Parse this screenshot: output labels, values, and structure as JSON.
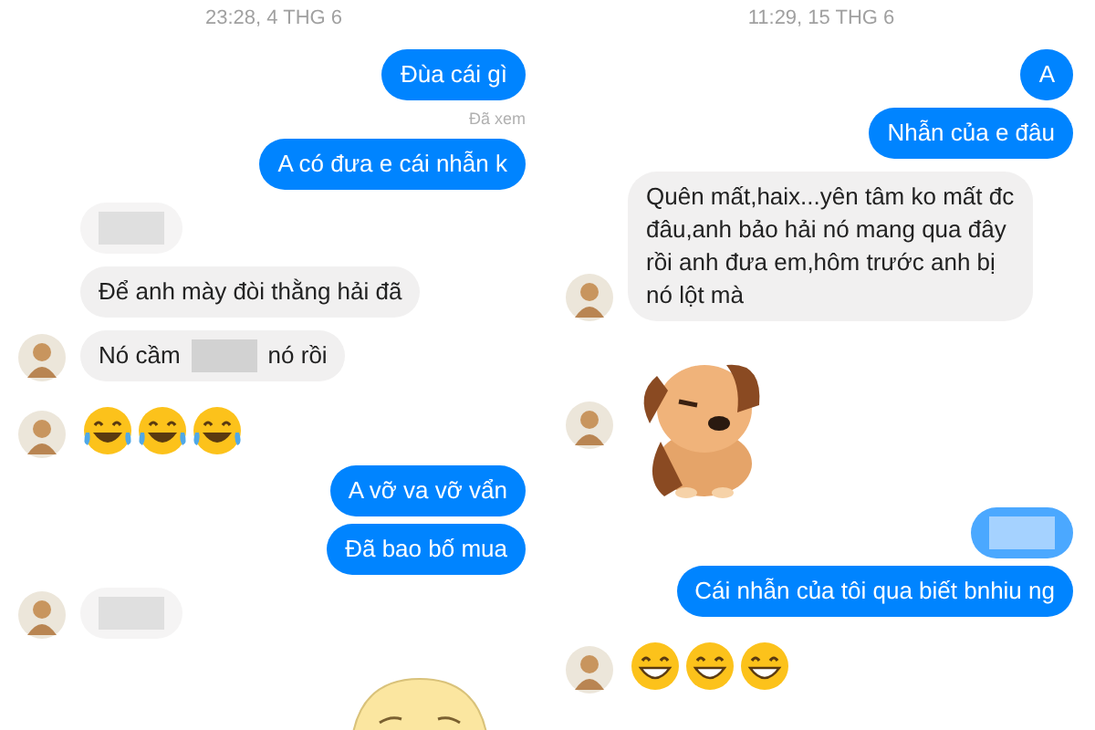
{
  "panels": [
    {
      "items": [
        {
          "kind": "timestamp",
          "text": "23:28, 4 THG 6"
        },
        {
          "kind": "outgoing_message",
          "parts": [
            {
              "kind": "text",
              "text": "Đùa cái gì"
            }
          ]
        },
        {
          "kind": "seen",
          "text": "Đã xem"
        },
        {
          "kind": "outgoing_message",
          "parts": [
            {
              "kind": "text",
              "text": "A có đưa e cái nhẫn k"
            }
          ]
        },
        {
          "kind": "incoming_message",
          "avatar": false,
          "parts": [
            {
              "kind": "redaction"
            }
          ]
        },
        {
          "kind": "incoming_message",
          "avatar": false,
          "parts": [
            {
              "kind": "text",
              "text": "Để anh mày đòi thằng hải đã"
            }
          ]
        },
        {
          "kind": "incoming_message",
          "avatar": true,
          "parts": [
            {
              "kind": "text",
              "text": "Nó cầm"
            },
            {
              "kind": "redaction"
            },
            {
              "kind": "text",
              "text": "nó rồi"
            }
          ]
        },
        {
          "kind": "emoji_row",
          "avatar": true,
          "emojis": [
            {
              "kind": "tears-of-joy"
            },
            {
              "kind": "tears-of-joy"
            },
            {
              "kind": "tears-of-joy"
            }
          ]
        },
        {
          "kind": "outgoing_message",
          "parts": [
            {
              "kind": "text",
              "text": "A vỡ va vỡ vẩn"
            }
          ]
        },
        {
          "kind": "outgoing_message",
          "parts": [
            {
              "kind": "text",
              "text": "Đã bao bố mua"
            }
          ]
        },
        {
          "kind": "incoming_message",
          "avatar": true,
          "parts": [
            {
              "kind": "redaction"
            }
          ]
        },
        {
          "kind": "outgoing_face_sticker"
        }
      ]
    },
    {
      "items": [
        {
          "kind": "timestamp",
          "text": "11:29, 15 THG 6"
        },
        {
          "kind": "outgoing_message",
          "parts": [
            {
              "kind": "text",
              "text": "A"
            }
          ]
        },
        {
          "kind": "outgoing_message",
          "parts": [
            {
              "kind": "text",
              "text": "Nhẫn của e đâu"
            }
          ]
        },
        {
          "kind": "incoming_message",
          "avatar": true,
          "parts": [
            {
              "kind": "text",
              "text": "Quên mất,haix...yên tâm ko mất đc đâu,anh bảo hải nó mang qua đây rồi anh đưa em,hôm trước anh bị nó lột mà"
            }
          ]
        },
        {
          "kind": "incoming_dog_sticker",
          "avatar": true
        },
        {
          "kind": "outgoing_message",
          "parts": [
            {
              "kind": "redaction"
            }
          ]
        },
        {
          "kind": "outgoing_message",
          "parts": [
            {
              "kind": "text",
              "text": "Cái nhẫn của tôi qua biết bnhiu ng"
            }
          ]
        },
        {
          "kind": "emoji_row",
          "avatar": true,
          "emojis": [
            {
              "kind": "grin"
            },
            {
              "kind": "grin"
            },
            {
              "kind": "grin"
            }
          ]
        }
      ]
    }
  ]
}
